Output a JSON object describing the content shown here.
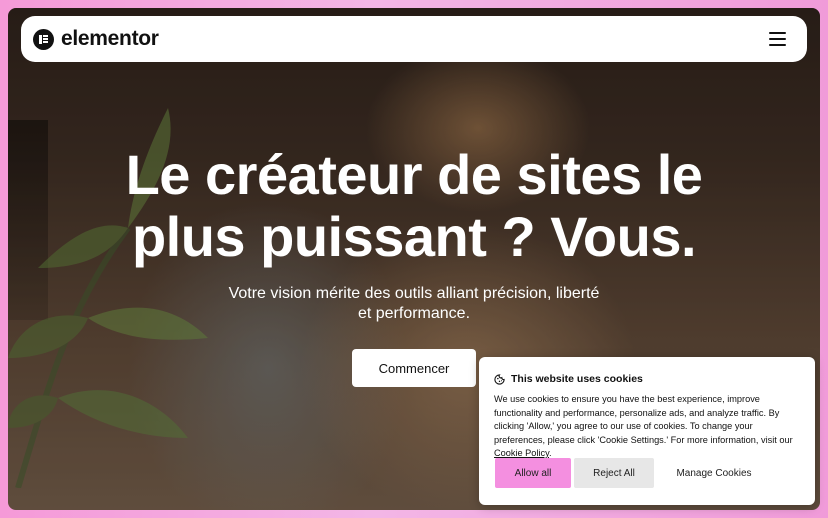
{
  "header": {
    "brand": "elementor"
  },
  "hero": {
    "title_line1": "Le créateur de sites le",
    "title_line2": "plus puissant ? Vous.",
    "subtitle_line1": "Votre vision mérite des outils alliant précision, liberté",
    "subtitle_line2": "et performance.",
    "cta_label": "Commencer"
  },
  "cookie_banner": {
    "title": "This website uses cookies",
    "body": "We use cookies to ensure you have the best experience, improve functionality and performance, personalize ads, and analyze traffic. By clicking 'Allow,' you agree to our use of cookies. To change your preferences, please click 'Cookie Settings.' For more information, visit our ",
    "link_label": "Cookie Policy",
    "body_end": ".",
    "allow_label": "Allow all",
    "reject_label": "Reject All",
    "manage_label": "Manage Cookies"
  },
  "colors": {
    "page_border": "#f3b6e6",
    "allow_button": "#f48fe0",
    "reject_button": "#e7e7e7"
  },
  "icons": {
    "brand": "elementor-logo-icon",
    "menu": "hamburger-menu-icon",
    "cookie": "cookie-icon"
  }
}
